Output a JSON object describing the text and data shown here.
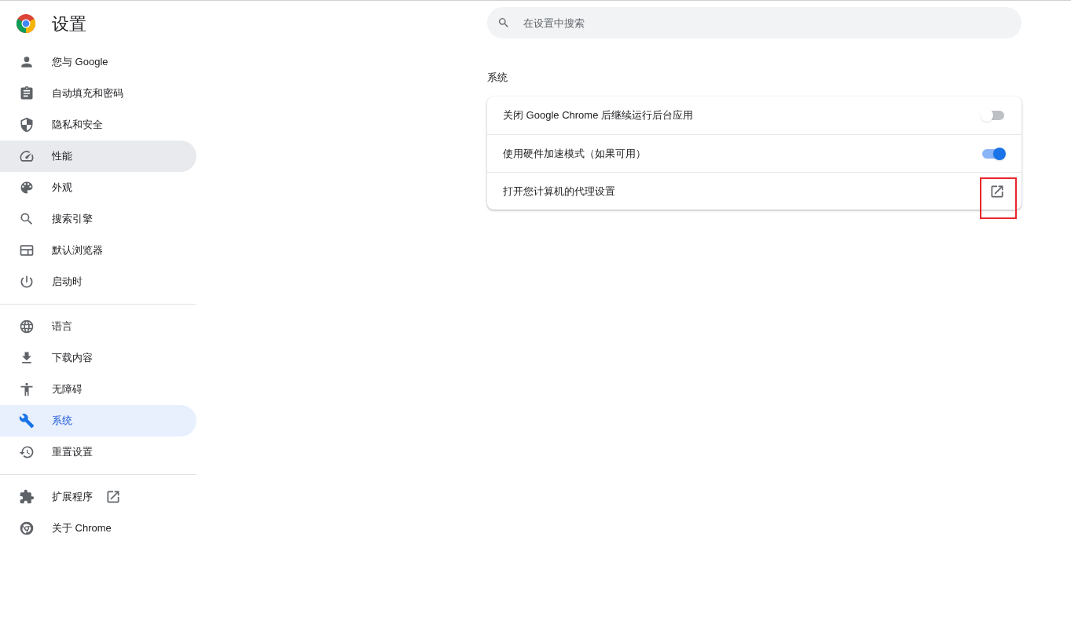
{
  "header": {
    "title": "设置"
  },
  "search": {
    "placeholder": "在设置中搜索"
  },
  "sidebar": {
    "groups": [
      {
        "items": [
          {
            "label": "您与 Google",
            "selected": false,
            "hovered": false,
            "external": false
          },
          {
            "label": "自动填充和密码",
            "selected": false,
            "hovered": false,
            "external": false
          },
          {
            "label": "隐私和安全",
            "selected": false,
            "hovered": false,
            "external": false
          },
          {
            "label": "性能",
            "selected": false,
            "hovered": true,
            "external": false
          },
          {
            "label": "外观",
            "selected": false,
            "hovered": false,
            "external": false
          },
          {
            "label": "搜索引擎",
            "selected": false,
            "hovered": false,
            "external": false
          },
          {
            "label": "默认浏览器",
            "selected": false,
            "hovered": false,
            "external": false
          },
          {
            "label": "启动时",
            "selected": false,
            "hovered": false,
            "external": false
          }
        ]
      },
      {
        "items": [
          {
            "label": "语言",
            "selected": false,
            "hovered": false,
            "external": false
          },
          {
            "label": "下载内容",
            "selected": false,
            "hovered": false,
            "external": false
          },
          {
            "label": "无障碍",
            "selected": false,
            "hovered": false,
            "external": false
          },
          {
            "label": "系统",
            "selected": true,
            "hovered": false,
            "external": false
          },
          {
            "label": "重置设置",
            "selected": false,
            "hovered": false,
            "external": false
          }
        ]
      },
      {
        "items": [
          {
            "label": "扩展程序",
            "selected": false,
            "hovered": false,
            "external": true
          },
          {
            "label": "关于 Chrome",
            "selected": false,
            "hovered": false,
            "external": false
          }
        ]
      }
    ]
  },
  "section": {
    "title": "系统",
    "rows": [
      {
        "kind": "toggle",
        "label": "关闭 Google Chrome 后继续运行后台应用",
        "on": false
      },
      {
        "kind": "toggle",
        "label": "使用硬件加速模式（如果可用）",
        "on": true
      },
      {
        "kind": "link",
        "label": "打开您计算机的代理设置",
        "highlighted": true
      }
    ]
  }
}
